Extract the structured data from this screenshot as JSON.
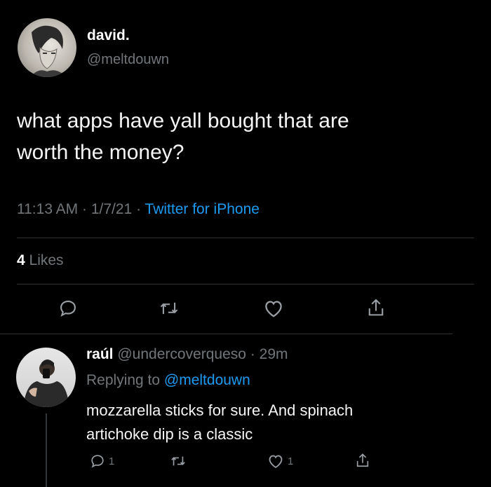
{
  "tweet": {
    "display_name": "david.",
    "handle": "@meltdouwn",
    "text_line1": "what apps have yall bought that are",
    "text_line2": "worth the money?",
    "time": "11:13 AM",
    "date": "1/7/21",
    "source": "Twitter for iPhone",
    "likes_count": "4",
    "likes_label": "Likes"
  },
  "reply": {
    "display_name": "raúl",
    "handle": "@undercoverqueso",
    "age": "29m",
    "replying_label": "Replying to",
    "replying_handle": "@meltdouwn",
    "text_line1": "mozzarella sticks for sure. And spinach",
    "text_line2": "artichoke dip is a classic",
    "reply_count": "1",
    "like_count": "1"
  },
  "colors": {
    "background": "#000000",
    "text": "#e7e9ea",
    "muted": "#71767b",
    "link": "#1d9bf0"
  },
  "icons": [
    "reply-icon",
    "retweet-icon",
    "like-icon",
    "share-icon"
  ]
}
